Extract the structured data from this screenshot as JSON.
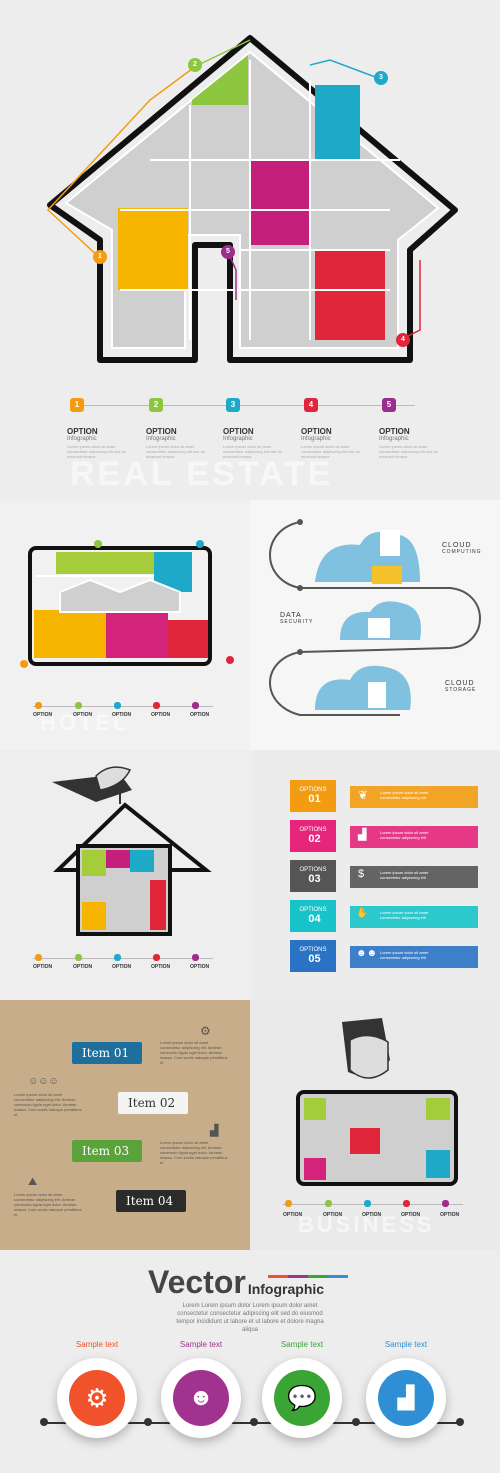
{
  "panel1": {
    "watermark": "REAL ESTATE",
    "markers": [
      "1",
      "2",
      "3",
      "4",
      "5"
    ],
    "options": [
      {
        "num": "1",
        "title": "OPTION",
        "sub": "Infographic",
        "lorem": "Lorem ipsum dolor sit amet consectetur adipiscing elit sed do eiusmod tempor"
      },
      {
        "num": "2",
        "title": "OPTION",
        "sub": "Infographic",
        "lorem": "Lorem ipsum dolor sit amet consectetur adipiscing elit sed do eiusmod tempor"
      },
      {
        "num": "3",
        "title": "OPTION",
        "sub": "Infographic",
        "lorem": "Lorem ipsum dolor sit amet consectetur adipiscing elit sed do eiusmod tempor"
      },
      {
        "num": "4",
        "title": "OPTION",
        "sub": "Infographic",
        "lorem": "Lorem ipsum dolor sit amet consectetur adipiscing elit sed do eiusmod tempor"
      },
      {
        "num": "5",
        "title": "OPTION",
        "sub": "Infographic",
        "lorem": "Lorem ipsum dolor sit amet consectetur adipiscing elit sed do eiusmod tempor"
      }
    ],
    "colors": [
      "#f39c12",
      "#8dc63f",
      "#1fa9c9",
      "#e0263b",
      "#9b2d8e"
    ]
  },
  "panel2": {
    "watermark": "HOTEL",
    "options": [
      "OPTION",
      "OPTION",
      "OPTION",
      "OPTION",
      "OPTION"
    ]
  },
  "panel3": {
    "labels": [
      {
        "a": "CLOUD",
        "b": "COMPUTING"
      },
      {
        "a": "DATA",
        "b": "SECURITY"
      },
      {
        "a": "CLOUD",
        "b": "STORAGE"
      }
    ]
  },
  "panel4": {
    "options": [
      "OPTION",
      "OPTION",
      "OPTION",
      "OPTION",
      "OPTION"
    ]
  },
  "panel5": {
    "options": [
      {
        "label": "OPTIONS",
        "num": "01",
        "color": "#f39c12"
      },
      {
        "label": "OPTIONS",
        "num": "02",
        "color": "#e6267a"
      },
      {
        "label": "OPTIONS",
        "num": "03",
        "color": "#555555"
      },
      {
        "label": "OPTIONS",
        "num": "04",
        "color": "#18c4c9"
      },
      {
        "label": "OPTIONS",
        "num": "05",
        "color": "#2a73c4"
      }
    ],
    "lorem": "Lorem ipsum dolor sit amet consectetur adipiscing elit"
  },
  "panel6": {
    "items": [
      {
        "label": "Item 01",
        "color": "#1f6f9d"
      },
      {
        "label": "Item 02",
        "color": "#f4f4f4"
      },
      {
        "label": "Item 03",
        "color": "#5aa33b"
      },
      {
        "label": "Item 04",
        "color": "#2b2b2b"
      }
    ],
    "lorem": "Lorem ipsum dolor sit amet consectetur adipiscing elit. Aenean commodo ligula eget dolor. Aenean massa. Cum sociis natoque penatibus et"
  },
  "panel7": {
    "watermark": "BUSINESS",
    "options": [
      "OPTION",
      "OPTION",
      "OPTION",
      "OPTION",
      "OPTION"
    ]
  },
  "panel8": {
    "title_big": "Vector",
    "title_small": "Infographic",
    "lorem": "Lorem Lorem ipsum dolor Lorem ipsum dolor amet consectetur consectetur adipiscing elit sed do eiusmod tempor incididunt ut labore et ut labore et dolore magna aliqua",
    "circles": [
      {
        "label": "Sample text",
        "color": "#f0522b",
        "icon": "gears-icon"
      },
      {
        "label": "Sample text",
        "color": "#a2328f",
        "icon": "user-icon"
      },
      {
        "label": "Sample text",
        "color": "#3aa535",
        "icon": "chat-icon"
      },
      {
        "label": "Sample text",
        "color": "#2e8fd4",
        "icon": "bar-chart-icon"
      }
    ]
  }
}
